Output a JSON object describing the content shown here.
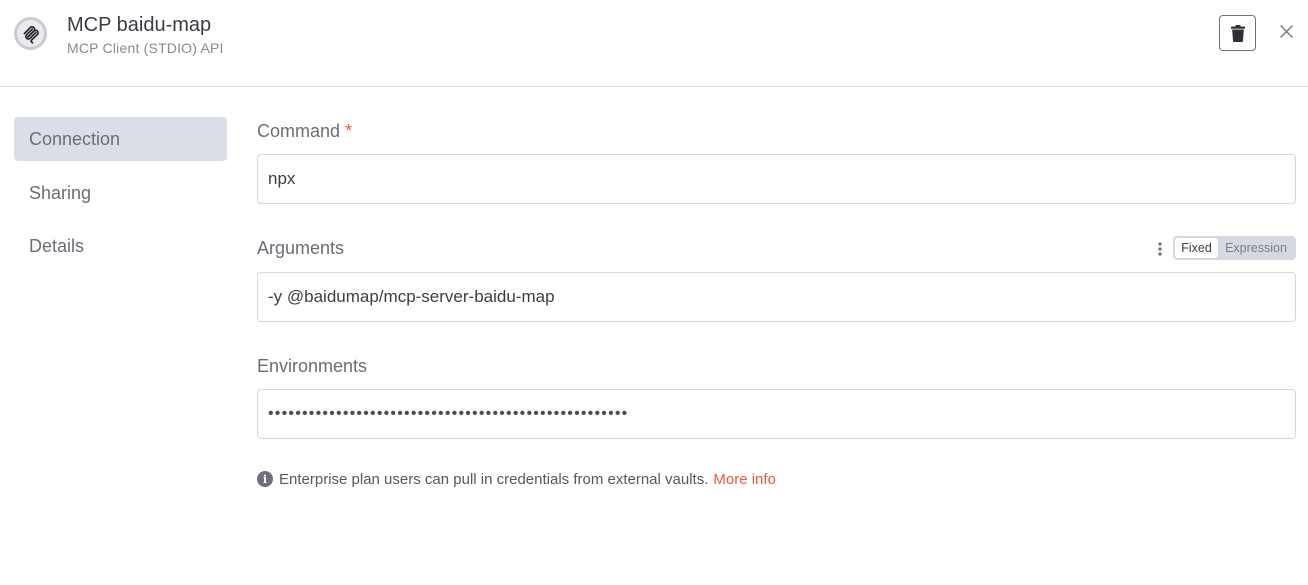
{
  "header": {
    "title": "MCP baidu-map",
    "subtitle": "MCP Client (STDIO) API",
    "icons": {
      "app": "mcp-logo-icon",
      "delete": "trash-icon",
      "close": "close-icon"
    }
  },
  "sidebar": {
    "items": [
      {
        "label": "Connection",
        "active": true
      },
      {
        "label": "Sharing",
        "active": false
      },
      {
        "label": "Details",
        "active": false
      }
    ]
  },
  "form": {
    "command": {
      "label": "Command",
      "required_mark": "*",
      "value": "npx"
    },
    "arguments": {
      "label": "Arguments",
      "value": "-y @baidumap/mcp-server-baidu-map",
      "mode_toggle": {
        "fixed": "Fixed",
        "expression": "Expression",
        "selected": "Fixed"
      }
    },
    "environments": {
      "label": "Environments",
      "value": "•••••••••••••••••••••••••••••••••••••••••••••••••••••"
    },
    "info": {
      "text": "Enterprise plan users can pull in credentials from external vaults.",
      "link": "More info"
    }
  },
  "colors": {
    "accent": "#ea5a45",
    "active_nav": "#dbdee7",
    "border": "#d6d8dd"
  }
}
